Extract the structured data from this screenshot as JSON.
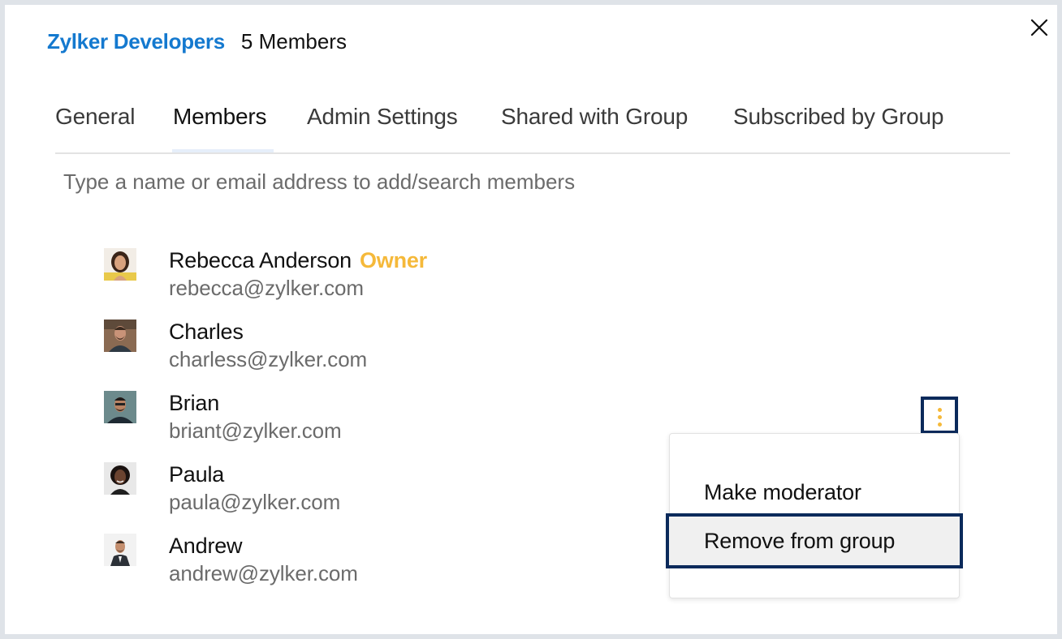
{
  "header": {
    "group_name": "Zylker Developers",
    "member_count": "5 Members"
  },
  "tabs": [
    {
      "label": "General"
    },
    {
      "label": "Members",
      "active": true
    },
    {
      "label": "Admin Settings"
    },
    {
      "label": "Shared with Group"
    },
    {
      "label": "Subscribed by Group"
    }
  ],
  "search": {
    "placeholder": "Type a name or email address to add/search members",
    "value": ""
  },
  "members": [
    {
      "name": "Rebecca Anderson",
      "badge": "Owner",
      "email": "rebecca@zylker.com"
    },
    {
      "name": "Charles",
      "email": "charless@zylker.com"
    },
    {
      "name": "Brian",
      "email": "briant@zylker.com"
    },
    {
      "name": "Paula",
      "email": "paula@zylker.com"
    },
    {
      "name": "Andrew",
      "email": "andrew@zylker.com"
    }
  ],
  "context_menu": {
    "items": [
      {
        "label": "Make moderator"
      },
      {
        "label": "Remove from group",
        "highlighted": true
      }
    ]
  },
  "icons": {
    "close": "close-icon",
    "more": "more-vertical-icon"
  },
  "colors": {
    "brand": "#1479cf",
    "owner_badge": "#f5b93a",
    "highlight_border": "#0b2a5b"
  }
}
